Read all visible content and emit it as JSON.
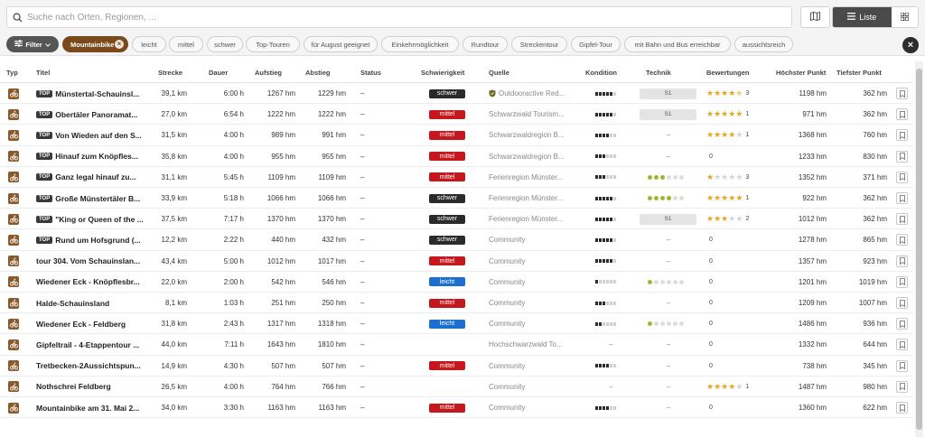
{
  "search": {
    "placeholder": "Suche nach Orten, Regionen, ..."
  },
  "view": {
    "list_label": "Liste"
  },
  "filters": {
    "filter_label": "Filter",
    "active": "Mountainbike",
    "chips": [
      "leicht",
      "mittel",
      "schwer",
      "Top-Touren",
      "für August geeignet",
      "Einkehrmöglichkeit",
      "Rundtour",
      "Streckentour",
      "Gipfel-Tour",
      "mit Bahn und Bus erreichbar",
      "aussichtsreich"
    ]
  },
  "columns": {
    "typ": "Typ",
    "titel": "Titel",
    "strecke": "Strecke",
    "dauer": "Dauer",
    "aufstieg": "Aufstieg",
    "abstieg": "Abstieg",
    "status": "Status",
    "schwierigkeit": "Schwierigkeit",
    "quelle": "Quelle",
    "kondition": "Kondition",
    "technik": "Technik",
    "bewertungen": "Bewertungen",
    "hoechster": "Höchster Punkt",
    "tiefster": "Tiefster Punkt"
  },
  "colors": {
    "schwer": "#2b2b2b",
    "mittel": "#c8161d",
    "leicht": "#1b6fcf",
    "star": "#e3a81b",
    "tech_dot": "#9bb833",
    "chip_active": "#7a4a1c"
  },
  "rows": [
    {
      "top": true,
      "title": "Münstertal-Schauinsl...",
      "strecke": "39,1 km",
      "dauer": "6:00 h",
      "auf": "1267 hm",
      "ab": "1229 hm",
      "status": "–",
      "diff": "schwer",
      "src": "Outdooractive Red...",
      "src_icon": true,
      "kond": 5,
      "tech_bar": "S1",
      "tech_dots": null,
      "stars": 4.5,
      "rcount": "3",
      "high": "1198 hm",
      "low": "362 hm"
    },
    {
      "top": true,
      "title": "Obertäler Panoramat...",
      "strecke": "27,0 km",
      "dauer": "6:54 h",
      "auf": "1222 hm",
      "ab": "1222 hm",
      "status": "–",
      "diff": "mittel",
      "src": "Schwarzwald Tourism...",
      "src_icon": false,
      "kond": 5,
      "tech_bar": "S1",
      "tech_dots": null,
      "stars": 5,
      "rcount": "1",
      "high": "971 hm",
      "low": "362 hm"
    },
    {
      "top": true,
      "title": "Von Wieden auf den S...",
      "strecke": "31,5 km",
      "dauer": "4:00 h",
      "auf": "989 hm",
      "ab": "991 hm",
      "status": "–",
      "diff": "mittel",
      "src": "Schwarzwaldregion B...",
      "src_icon": false,
      "kond": 4,
      "tech_bar": null,
      "tech_dots": null,
      "stars": 4,
      "rcount": "1",
      "high": "1368 hm",
      "low": "760 hm"
    },
    {
      "top": true,
      "title": "Hinauf zum Knöpfles...",
      "strecke": "35,8 km",
      "dauer": "4:00 h",
      "auf": "955 hm",
      "ab": "955 hm",
      "status": "–",
      "diff": "mittel",
      "src": "Schwarzwaldregion B...",
      "src_icon": false,
      "kond": 3,
      "tech_bar": null,
      "tech_dots": null,
      "stars": 0,
      "rcount": "0",
      "high": "1233 hm",
      "low": "830 hm"
    },
    {
      "top": true,
      "title": "Ganz legal hinauf zu...",
      "strecke": "31,1 km",
      "dauer": "5:45 h",
      "auf": "1109 hm",
      "ab": "1109 hm",
      "status": "–",
      "diff": "mittel",
      "src": "Ferienregion Münster...",
      "src_icon": false,
      "kond": 3,
      "tech_bar": null,
      "tech_dots": 3,
      "stars": 1,
      "rcount": "3",
      "high": "1352 hm",
      "low": "371 hm"
    },
    {
      "top": true,
      "title": "Große Münstertäler B...",
      "strecke": "33,9 km",
      "dauer": "5:18 h",
      "auf": "1066 hm",
      "ab": "1066 hm",
      "status": "–",
      "diff": "schwer",
      "src": "Ferienregion Münster...",
      "src_icon": false,
      "kond": 5,
      "tech_bar": null,
      "tech_dots": 4,
      "stars": 5,
      "rcount": "1",
      "high": "922 hm",
      "low": "362 hm"
    },
    {
      "top": true,
      "title": "\"King or Queen of the ...",
      "strecke": "37,5 km",
      "dauer": "7:17 h",
      "auf": "1370 hm",
      "ab": "1370 hm",
      "status": "–",
      "diff": "schwer",
      "src": "Ferienregion Münster...",
      "src_icon": false,
      "kond": 5,
      "tech_bar": "S1",
      "tech_dots": null,
      "stars": 3,
      "rcount": "2",
      "high": "1012 hm",
      "low": "362 hm"
    },
    {
      "top": true,
      "title": "Rund um Hofsgrund (...",
      "strecke": "12,2 km",
      "dauer": "2:22 h",
      "auf": "440 hm",
      "ab": "432 hm",
      "status": "–",
      "diff": "schwer",
      "src": "Community",
      "src_icon": false,
      "kond": 5,
      "tech_bar": null,
      "tech_dots": null,
      "stars": 0,
      "rcount": "0",
      "high": "1278 hm",
      "low": "865 hm"
    },
    {
      "top": false,
      "title": "tour 304. Vom Schauinslan...",
      "strecke": "43,4 km",
      "dauer": "5:00 h",
      "auf": "1012 hm",
      "ab": "1017 hm",
      "status": "–",
      "diff": "mittel",
      "src": "Community",
      "src_icon": false,
      "kond": 5,
      "tech_bar": null,
      "tech_dots": null,
      "stars": 0,
      "rcount": "0",
      "high": "1357 hm",
      "low": "923 hm"
    },
    {
      "top": false,
      "title": "Wiedener Eck - Knöpflesbr...",
      "strecke": "22,0 km",
      "dauer": "2:00 h",
      "auf": "542 hm",
      "ab": "546 hm",
      "status": "–",
      "diff": "leicht",
      "src": "Community",
      "src_icon": false,
      "kond": 1,
      "tech_bar": null,
      "tech_dots": 1,
      "stars": 0,
      "rcount": "0",
      "high": "1201 hm",
      "low": "1019 hm"
    },
    {
      "top": false,
      "title": "Halde-Schauinsland",
      "strecke": "8,1 km",
      "dauer": "1:03 h",
      "auf": "251 hm",
      "ab": "250 hm",
      "status": "–",
      "diff": "mittel",
      "src": "Community",
      "src_icon": false,
      "kond": 3,
      "tech_bar": null,
      "tech_dots": null,
      "stars": 0,
      "rcount": "0",
      "high": "1209 hm",
      "low": "1007 hm"
    },
    {
      "top": false,
      "title": "Wiedener Eck - Feldberg",
      "strecke": "31,8 km",
      "dauer": "2:43 h",
      "auf": "1317 hm",
      "ab": "1318 hm",
      "status": "–",
      "diff": "leicht",
      "src": "Community",
      "src_icon": false,
      "kond": 2,
      "tech_bar": null,
      "tech_dots": 1,
      "stars": 0,
      "rcount": "0",
      "high": "1486 hm",
      "low": "936 hm"
    },
    {
      "top": false,
      "title": "Gipfeltrail - 4-Etappentour ...",
      "strecke": "44,0 km",
      "dauer": "7:11 h",
      "auf": "1643 hm",
      "ab": "1810 hm",
      "status": "–",
      "diff": "",
      "src": "Hochschwarzwald To...",
      "src_icon": false,
      "kond": 0,
      "tech_bar": null,
      "tech_dots": null,
      "stars": 0,
      "rcount": "0",
      "high": "1332 hm",
      "low": "644 hm"
    },
    {
      "top": false,
      "title": "Tretbecken-2Aussichtspun...",
      "strecke": "14,9 km",
      "dauer": "4:30 h",
      "auf": "507 hm",
      "ab": "507 hm",
      "status": "–",
      "diff": "mittel",
      "src": "Community",
      "src_icon": false,
      "kond": 4,
      "tech_bar": null,
      "tech_dots": null,
      "stars": 0,
      "rcount": "0",
      "high": "738 hm",
      "low": "345 hm"
    },
    {
      "top": false,
      "title": "Nothschrei Feldberg",
      "strecke": "26,5 km",
      "dauer": "4:00 h",
      "auf": "764 hm",
      "ab": "766 hm",
      "status": "–",
      "diff": "",
      "src": "Community",
      "src_icon": false,
      "kond": 0,
      "tech_bar": null,
      "tech_dots": null,
      "stars": 4,
      "rcount": "1",
      "high": "1487 hm",
      "low": "980 hm"
    },
    {
      "top": false,
      "title": "Mountainbike am 31. Mai 2...",
      "strecke": "34,0 km",
      "dauer": "3:30 h",
      "auf": "1163 hm",
      "ab": "1163 hm",
      "status": "–",
      "diff": "mittel",
      "src": "Community",
      "src_icon": false,
      "kond": 4,
      "tech_bar": null,
      "tech_dots": null,
      "stars": 0,
      "rcount": "0",
      "high": "1360 hm",
      "low": "622 hm"
    }
  ]
}
